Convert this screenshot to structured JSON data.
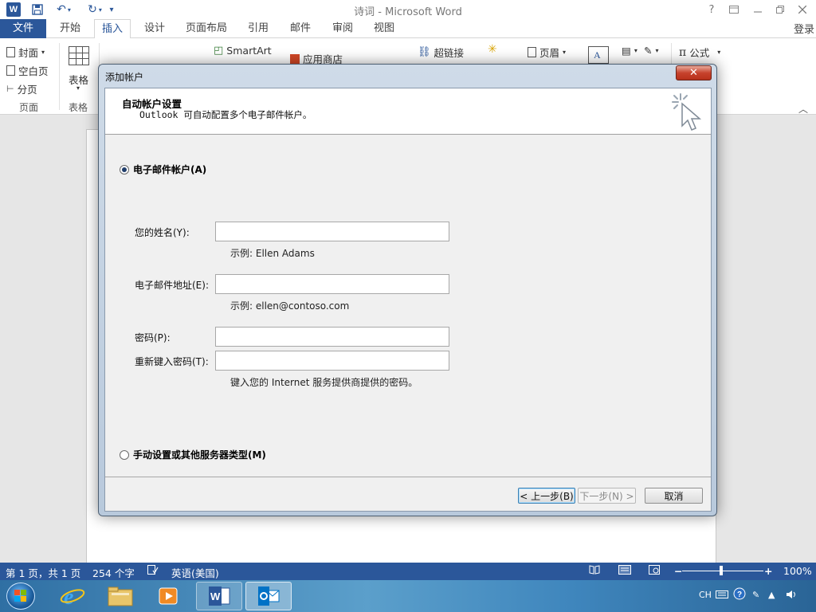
{
  "window": {
    "title": "诗词 - Microsoft Word",
    "app_icon_letter": "W",
    "help": "?",
    "login": "登录"
  },
  "tabs": [
    "文件",
    "开始",
    "插入",
    "设计",
    "页面布局",
    "引用",
    "邮件",
    "审阅",
    "视图"
  ],
  "ribbon": {
    "cover": "封面",
    "blank_page": "空白页",
    "page_break": "分页",
    "table": "表格",
    "group_pages": "页面",
    "group_table": "表格",
    "smartart": "SmartArt",
    "app_store": "应用商店",
    "hyperlink": "超链接",
    "header": "页眉",
    "equation": "公式"
  },
  "dialog": {
    "title": "添加帐户",
    "header_title": "自动帐户设置",
    "header_subtitle": "Outlook 可自动配置多个电子邮件帐户。",
    "email_radio": "电子邮件帐户(A)",
    "name_label": "您的姓名(Y):",
    "name_hint": "示例: Ellen Adams",
    "email_label": "电子邮件地址(E):",
    "email_hint": "示例: ellen@contoso.com",
    "password_label": "密码(P):",
    "retype_label": "重新键入密码(T):",
    "password_hint": "键入您的 Internet 服务提供商提供的密码。",
    "manual_radio": "手动设置或其他服务器类型(M)",
    "back_button": "< 上一步(B)",
    "next_button": "下一步(N) >",
    "cancel_button": "取消",
    "close_glyph": "✕"
  },
  "status": {
    "page": "第 1 页，共 1 页",
    "words": "254 个字",
    "language": "英语(美国)",
    "zoom": "100%"
  },
  "tray": {
    "input_method": "CH"
  },
  "colors": {
    "word_blue": "#2b579a",
    "dialog_frame": "#b8c9dc",
    "close_red": "#c7432d"
  }
}
